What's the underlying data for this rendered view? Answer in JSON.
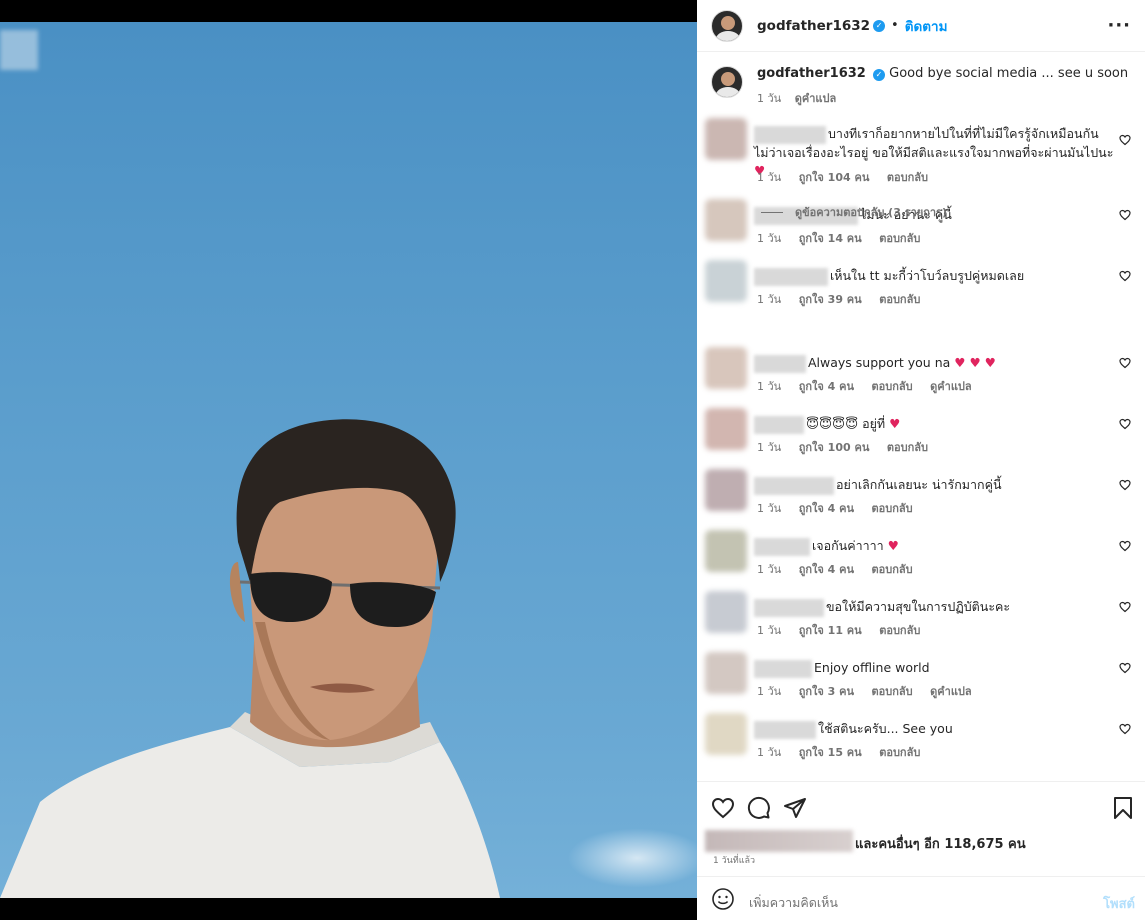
{
  "post": {
    "username": "godfather1632",
    "follow_label": "ติดตาม",
    "caption_text": "Good bye social media ... see u soon",
    "caption_time": "1 วัน",
    "caption_translate": "ดูคำแปล"
  },
  "comments": [
    {
      "name_width": 72,
      "text": "บางทีเราก็อยากหายไปในที่ที่ไม่มีใครรู้จักเหมือนกัน ไม่ว่าเจอเรื่องอะไรอยู่ ขอให้มีสติและแรงใจมากพอที่จะผ่านมันไปนะ",
      "heart": "♥",
      "time": "1 วัน",
      "likes": "ถูกใจ 104 คน",
      "reply": "ตอบกลับ",
      "translate": ""
    },
    {
      "name_width": 104,
      "text": "ไม่นะ อย่านะ คู่นี้",
      "heart": "",
      "time": "1 วัน",
      "likes": "ถูกใจ 14 คน",
      "reply": "ตอบกลับ",
      "translate": ""
    },
    {
      "name_width": 74,
      "text": "เห็นใน tt มะกี้ว่าโบว์ลบรูปคู่หมดเลย",
      "heart": "",
      "time": "1 วัน",
      "likes": "ถูกใจ 39 คน",
      "reply": "ตอบกลับ",
      "translate": ""
    },
    {
      "name_width": 52,
      "text": "Always support you na",
      "heart": "♥ ♥ ♥",
      "time": "1 วัน",
      "likes": "ถูกใจ 4 คน",
      "reply": "ตอบกลับ",
      "translate": "ดูคำแปล"
    },
    {
      "name_width": 50,
      "text": "😇😇😇😇 อยู่ที่",
      "heart": "♥",
      "time": "1 วัน",
      "likes": "ถูกใจ 100 คน",
      "reply": "ตอบกลับ",
      "translate": ""
    },
    {
      "name_width": 80,
      "text": "อย่าเลิกกันเลยนะ น่ารักมากคู่นี้",
      "heart": "",
      "time": "1 วัน",
      "likes": "ถูกใจ 4 คน",
      "reply": "ตอบกลับ",
      "translate": ""
    },
    {
      "name_width": 56,
      "text": "เจอกันค่าาาา",
      "heart": "♥",
      "time": "1 วัน",
      "likes": "ถูกใจ 4 คน",
      "reply": "ตอบกลับ",
      "translate": ""
    },
    {
      "name_width": 70,
      "text": "ขอให้มีความสุขในการปฏิบัตินะคะ",
      "heart": "",
      "time": "1 วัน",
      "likes": "ถูกใจ 11 คน",
      "reply": "ตอบกลับ",
      "translate": ""
    },
    {
      "name_width": 58,
      "text": "Enjoy offline world",
      "heart": "",
      "time": "1 วัน",
      "likes": "ถูกใจ 3 คน",
      "reply": "ตอบกลับ",
      "translate": "ดูคำแปล"
    },
    {
      "name_width": 62,
      "text": "ใช้สตินะครับ... See you",
      "heart": "",
      "time": "1 วัน",
      "likes": "ถูกใจ 15 คน",
      "reply": "ตอบกลับ",
      "translate": ""
    }
  ],
  "view_replies": "ดูข้อความตอบกลับ (3 รายการ)",
  "likes_summary": "และคนอื่นๆ อีก 118,675 คน",
  "time_ago": "1 วันที่แล้ว",
  "add_comment_placeholder": "เพิ่มความคิดเห็น",
  "post_button": "โพสต์",
  "colors": {
    "accent": "#0095f6",
    "like_red": "#e0245e",
    "sky": "#5a9dcc"
  }
}
